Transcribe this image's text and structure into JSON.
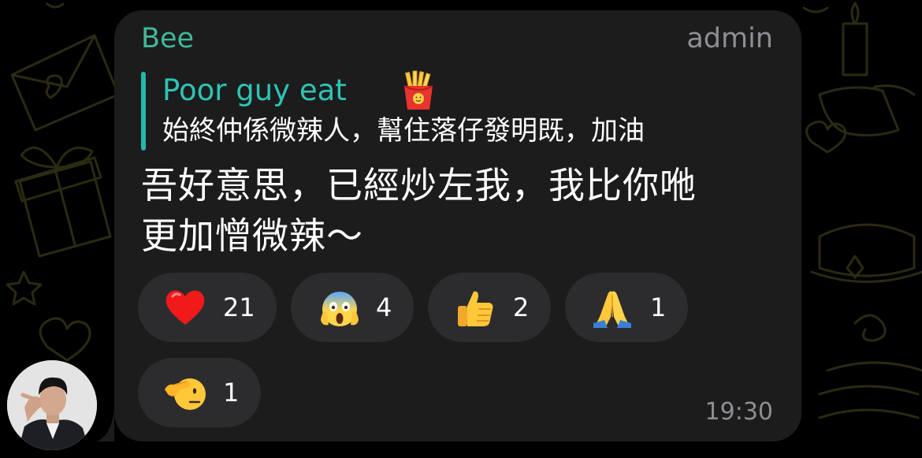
{
  "message": {
    "sender_name": "Bee",
    "sender_role": "admin",
    "reply": {
      "author": "Poor guy eat",
      "author_emoji": "french-fries-icon",
      "text": "始終仲係微辣人，幫住落仔發明既，加油"
    },
    "body_lines": [
      "吾好意思，已經炒左我，我比你咃",
      "更加憎微辣～"
    ],
    "time": "19:30"
  },
  "reactions": [
    {
      "emoji": "red-heart-icon",
      "count": "21"
    },
    {
      "emoji": "face-screaming-in-fear-icon",
      "count": "4"
    },
    {
      "emoji": "thumbs-up-icon",
      "count": "2"
    },
    {
      "emoji": "folded-hands-icon",
      "count": "1"
    },
    {
      "emoji": "saluting-face-icon",
      "count": "1"
    }
  ],
  "colors": {
    "background": "#000000",
    "bubble": "#1c1c1d",
    "reaction_chip": "#2c2c2e",
    "sender_name": "#3fb99a",
    "reply_accent": "#22b9a9",
    "meta_text": "#8e8e93",
    "body_text": "#ffffff"
  }
}
